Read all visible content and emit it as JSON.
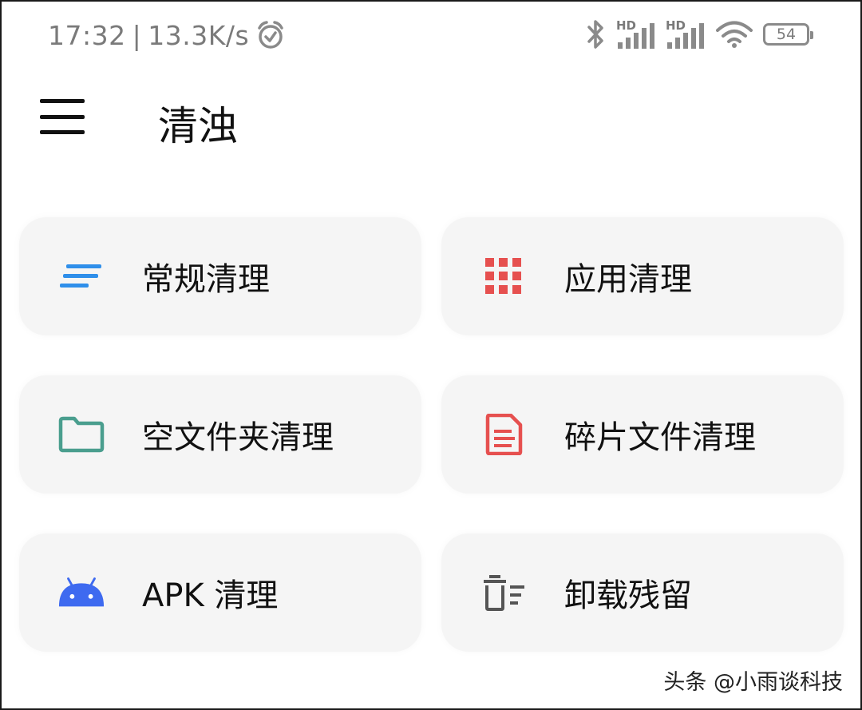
{
  "status_bar": {
    "time": "17:32",
    "separator": "|",
    "net_speed": "13.3K/s",
    "hd1": "HD",
    "hd2": "HD",
    "battery": "54",
    "icons": [
      "alarm-icon",
      "bluetooth-icon",
      "signal-icon",
      "signal-icon",
      "wifi-icon",
      "battery-icon"
    ]
  },
  "app_bar": {
    "title": "清浊",
    "menu_icon": "hamburger-menu-icon"
  },
  "cards": [
    {
      "label": "常规清理",
      "icon": "lines-icon",
      "color": "#2f8fea"
    },
    {
      "label": "应用清理",
      "icon": "grid-icon",
      "color": "#e6504f"
    },
    {
      "label": "空文件夹清理",
      "icon": "folder-icon",
      "color": "#4a9e8e"
    },
    {
      "label": "碎片文件清理",
      "icon": "document-icon",
      "color": "#e6504f"
    },
    {
      "label": "APK 清理",
      "icon": "android-icon",
      "color": "#3e6af0"
    },
    {
      "label": "卸载残留",
      "icon": "trash-list-icon",
      "color": "#555555"
    }
  ],
  "watermark": "头条 @小雨谈科技"
}
